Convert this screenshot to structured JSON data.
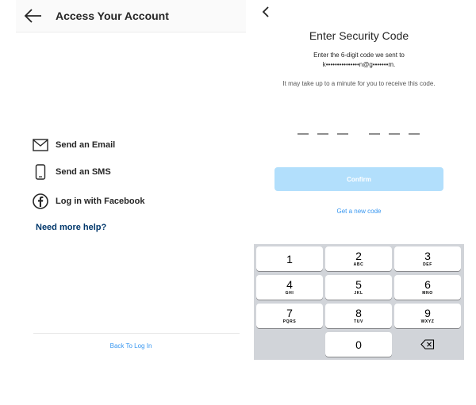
{
  "left_screen": {
    "title": "Access Your Account",
    "back_icon": "left-arrow-icon",
    "options": [
      {
        "label": "Send an Email",
        "icon": "mail-icon"
      },
      {
        "label": "Send an SMS",
        "icon": "phone-icon"
      },
      {
        "label": "Log in with Facebook",
        "icon": "facebook-icon"
      }
    ],
    "help_link": "Need more help?",
    "back_to_login": "Back To Log In"
  },
  "right_screen": {
    "back_icon": "chevron-left-icon",
    "title": "Enter Security Code",
    "instruction": "Enter the 6-digit code we sent to",
    "masked_email": "k•••••••••••••••n@g•••••••m.",
    "wait_note": "It may take up to a minute for you to receive this code.",
    "code_digits": 6,
    "confirm_label": "Confirm",
    "new_code_link": "Get a new code",
    "keypad": [
      {
        "num": "1",
        "letters": ""
      },
      {
        "num": "2",
        "letters": "ABC"
      },
      {
        "num": "3",
        "letters": "DEF"
      },
      {
        "num": "4",
        "letters": "GHI"
      },
      {
        "num": "5",
        "letters": "JKL"
      },
      {
        "num": "6",
        "letters": "MNO"
      },
      {
        "num": "7",
        "letters": "PQRS"
      },
      {
        "num": "8",
        "letters": "TUV"
      },
      {
        "num": "9",
        "letters": "WXYZ"
      },
      {
        "num": "0",
        "letters": ""
      }
    ],
    "delete_icon": "backspace-icon"
  },
  "colors": {
    "link_blue": "#3897f0",
    "help_dark_blue": "#00376b",
    "confirm_disabled": "#b2dffc",
    "keypad_bg": "#d1d4d9"
  }
}
